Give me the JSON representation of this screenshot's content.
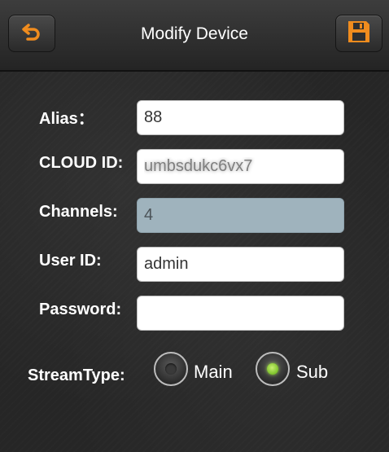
{
  "header": {
    "title": "Modify Device",
    "back_icon": "back-arrow-icon",
    "save_icon": "save-icon",
    "accent_color": "#f08c1e"
  },
  "form": {
    "alias": {
      "label": "Alias：",
      "value": "88"
    },
    "cloud_id": {
      "label": "CLOUD ID:",
      "value": "umbsdukc6vx7"
    },
    "channels": {
      "label": "Channels:",
      "value": "4"
    },
    "user_id": {
      "label": "User ID:",
      "value": "admin"
    },
    "password": {
      "label": "Password:",
      "value": ""
    }
  },
  "stream_type": {
    "label": "StreamType:",
    "options": [
      {
        "label": "Main",
        "selected": false
      },
      {
        "label": "Sub",
        "selected": true
      }
    ],
    "selected_color": "#8fcf3a"
  }
}
